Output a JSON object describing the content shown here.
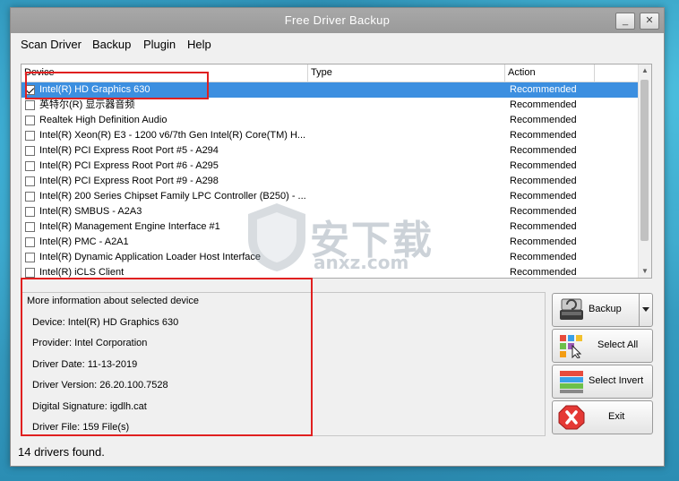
{
  "window": {
    "title": "Free Driver Backup"
  },
  "titlebar_buttons": {
    "minimize": "_",
    "close": "✕"
  },
  "menu": [
    "Scan Driver",
    "Backup",
    "Plugin",
    "Help"
  ],
  "list": {
    "columns": [
      "Device",
      "Type",
      "Action"
    ],
    "rows": [
      {
        "device": "Intel(R) HD Graphics 630",
        "type": "",
        "action": "Recommended",
        "checked": true,
        "selected": true
      },
      {
        "device": "英特尔(R) 显示器音频",
        "type": "",
        "action": "Recommended",
        "checked": false
      },
      {
        "device": "Realtek High Definition Audio",
        "type": "",
        "action": "Recommended",
        "checked": false
      },
      {
        "device": "Intel(R) Xeon(R) E3 - 1200 v6/7th Gen Intel(R) Core(TM) H...",
        "type": "",
        "action": "Recommended",
        "checked": false
      },
      {
        "device": "Intel(R) PCI Express Root Port #5 - A294",
        "type": "",
        "action": "Recommended",
        "checked": false
      },
      {
        "device": "Intel(R) PCI Express Root Port #6 - A295",
        "type": "",
        "action": "Recommended",
        "checked": false
      },
      {
        "device": "Intel(R) PCI Express Root Port #9 - A298",
        "type": "",
        "action": "Recommended",
        "checked": false
      },
      {
        "device": "Intel(R) 200 Series Chipset Family LPC Controller (B250) - ...",
        "type": "",
        "action": "Recommended",
        "checked": false
      },
      {
        "device": "Intel(R) SMBUS - A2A3",
        "type": "",
        "action": "Recommended",
        "checked": false
      },
      {
        "device": "Intel(R) Management Engine Interface #1",
        "type": "",
        "action": "Recommended",
        "checked": false
      },
      {
        "device": "Intel(R) PMC - A2A1",
        "type": "",
        "action": "Recommended",
        "checked": false
      },
      {
        "device": "Intel(R) Dynamic Application Loader Host Interface",
        "type": "",
        "action": "Recommended",
        "checked": false
      },
      {
        "device": "Intel(R) iCLS Client",
        "type": "",
        "action": "Recommended",
        "checked": false
      }
    ]
  },
  "info": {
    "title": "More information about selected device",
    "device": "Device:  Intel(R) HD Graphics 630",
    "provider": "Provider: Intel Corporation",
    "date": "Driver Date: 11-13-2019",
    "version": "Driver Version: 26.20.100.7528",
    "signature": "Digital Signature: igdlh.cat",
    "file": "Driver File: 159 File(s)"
  },
  "actions": {
    "backup": "Backup",
    "select_all": "Select All",
    "select_invert": "Select Invert",
    "exit": "Exit"
  },
  "status": "14 drivers found.",
  "watermark": {
    "text": "安下载",
    "url": "anxz.com"
  },
  "colors": {
    "selection": "#3c8fe0",
    "annotation_red": "#e02020",
    "titlebar": "#9f9f9f"
  }
}
